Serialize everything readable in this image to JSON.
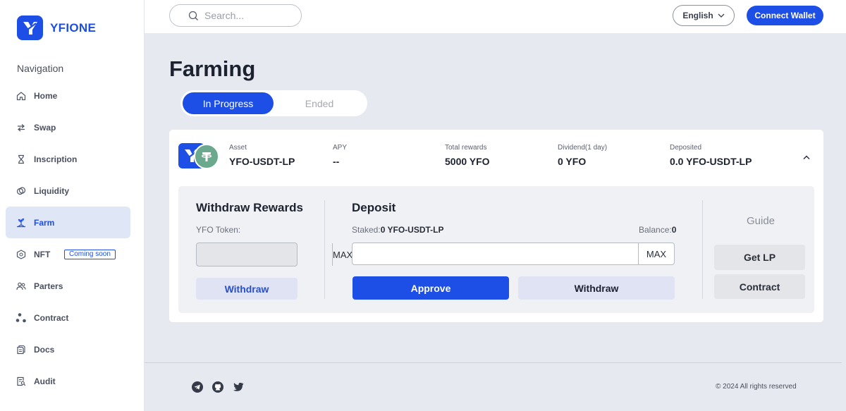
{
  "brand": {
    "name": "YFIONE",
    "accent": "#1d4ee6"
  },
  "search": {
    "placeholder": "Search..."
  },
  "header": {
    "language": "English",
    "connect_label": "Connect Wallet"
  },
  "sidebar": {
    "title": "Navigation",
    "items": [
      {
        "label": "Home",
        "icon": "home-icon"
      },
      {
        "label": "Swap",
        "icon": "swap-icon"
      },
      {
        "label": "Inscription",
        "icon": "hourglass-icon"
      },
      {
        "label": "Liquidity",
        "icon": "liquidity-icon"
      },
      {
        "label": "Farm",
        "icon": "farm-icon",
        "active": true
      },
      {
        "label": "NFT",
        "icon": "nft-icon",
        "badge": "Coming soon"
      },
      {
        "label": "Parters",
        "icon": "users-icon"
      },
      {
        "label": "Contract",
        "icon": "contract-icon"
      },
      {
        "label": "Docs",
        "icon": "docs-icon"
      },
      {
        "label": "Audit",
        "icon": "audit-icon"
      }
    ]
  },
  "main": {
    "title": "Farming",
    "tabs": [
      {
        "label": "In Progress",
        "active": true
      },
      {
        "label": "Ended",
        "active": false
      }
    ],
    "pool": {
      "asset_label": "Asset",
      "asset_value": "YFO-USDT-LP",
      "apy_label": "APY",
      "apy_value": "--",
      "total_label": "Total rewards",
      "total_value": "5000 YFO",
      "dividend_label": "Dividend(1 day)",
      "dividend_value": "0 YFO",
      "deposited_label": "Deposited",
      "deposited_value": "0.0 YFO-USDT-LP"
    },
    "withdraw_rewards": {
      "title": "Withdraw Rewards",
      "token_label": "YFO Token:",
      "max_label": "MAX",
      "button": "Withdraw"
    },
    "deposit": {
      "title": "Deposit",
      "staked_label": "Staked:",
      "staked_value": "0 YFO-USDT-LP",
      "balance_label": "Balance:",
      "balance_value": "0",
      "max_label": "MAX",
      "approve_button": "Approve",
      "withdraw_button": "Withdraw"
    },
    "guide": {
      "title": "Guide",
      "get_lp": "Get LP",
      "contract": "Contract"
    }
  },
  "footer": {
    "socials": [
      "telegram-icon",
      "github-icon",
      "twitter-icon"
    ],
    "copyright": "© 2024 All rights reserved"
  }
}
